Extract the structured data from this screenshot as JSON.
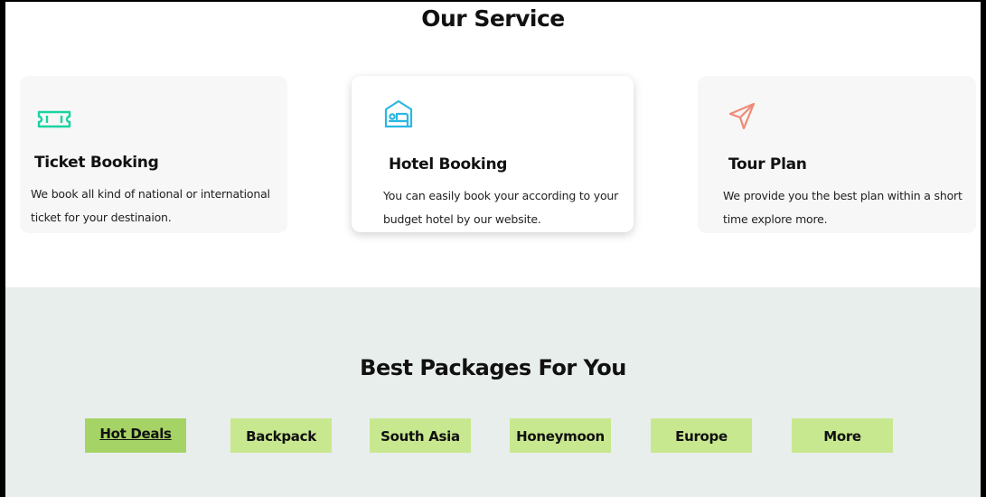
{
  "services": {
    "title": "Our Service",
    "cards": [
      {
        "title": "Ticket Booking",
        "text_line1": "We book all kind of national or international",
        "text_line2": "ticket for your destinaion.",
        "icon": "ticket-icon",
        "icon_color": "#19d3a2"
      },
      {
        "title": "Hotel Booking",
        "text_line1": "You can easily book your according to your",
        "text_line2": "budget hotel by our website.",
        "icon": "hotel-bed-icon",
        "icon_color": "#2bb7e3"
      },
      {
        "title": "Tour Plan",
        "text_line1": "We provide you the best plan within a short",
        "text_line2": "time explore more.",
        "icon": "paper-plane-icon",
        "icon_color": "#f08a77"
      }
    ]
  },
  "packages": {
    "title": "Best Packages For You",
    "tabs": [
      {
        "label": "Hot Deals",
        "active": true
      },
      {
        "label": "Backpack"
      },
      {
        "label": "South Asia"
      },
      {
        "label": "Honeymoon"
      },
      {
        "label": "Europe"
      },
      {
        "label": "More"
      }
    ],
    "active_color": "#a6d365",
    "tab_color": "#c8e88f",
    "background": "#e8eeec"
  }
}
